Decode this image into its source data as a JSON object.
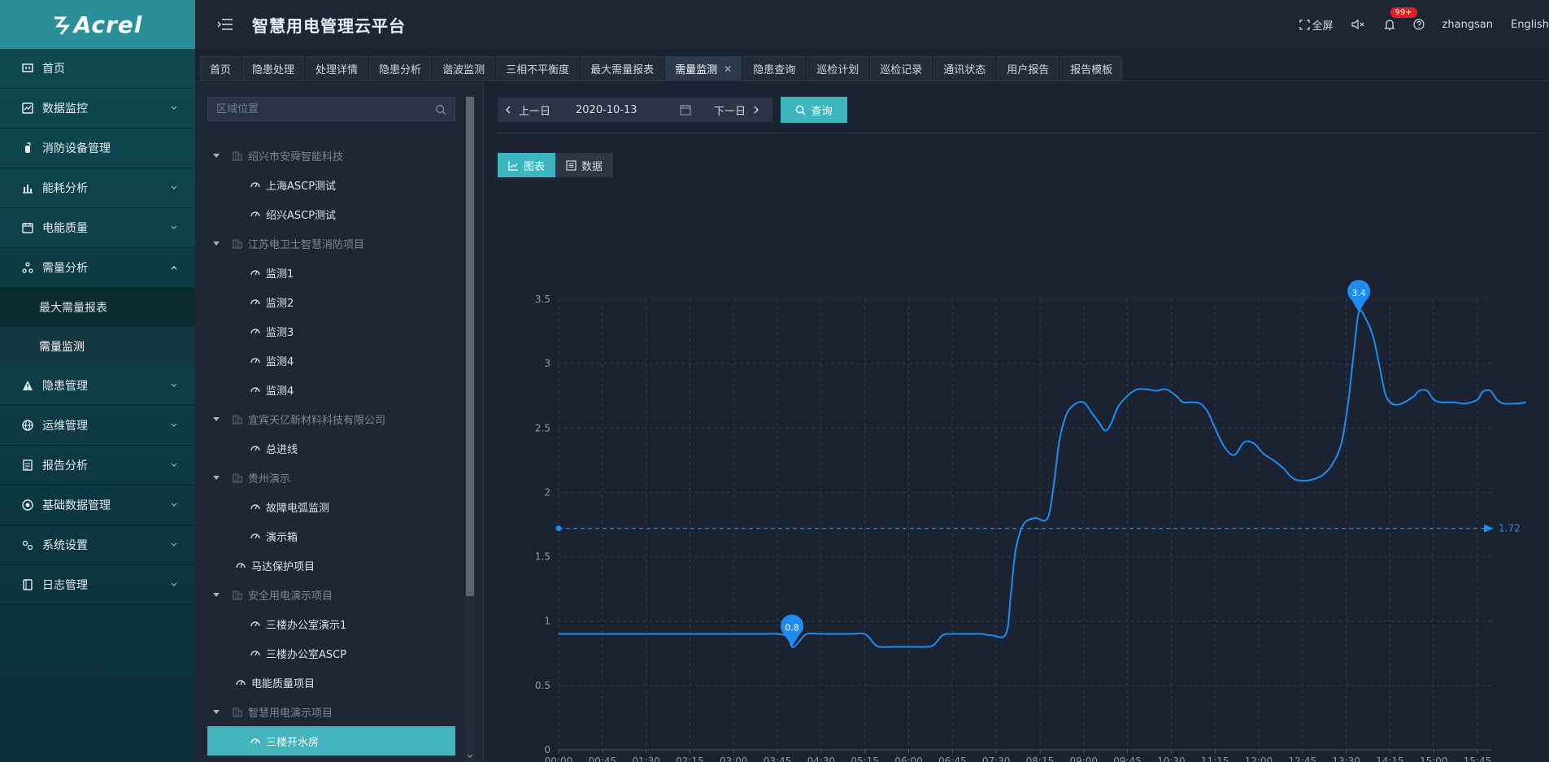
{
  "app": {
    "logo": "Acrel",
    "title": "智慧用电管理云平台"
  },
  "header": {
    "fullscreen": "全屏",
    "badge": "99+",
    "user": "zhangsan",
    "language": "English"
  },
  "sidebar": {
    "items": [
      {
        "label": "首页",
        "icon": "home-icon"
      },
      {
        "label": "数据监控",
        "icon": "monitor-icon"
      },
      {
        "label": "消防设备管理",
        "icon": "extinguisher-icon"
      },
      {
        "label": "能耗分析",
        "icon": "bar-chart-icon"
      },
      {
        "label": "电能质量",
        "icon": "calendar-icon"
      },
      {
        "label": "需量分析",
        "icon": "nodes-icon"
      },
      {
        "label": "隐患管理",
        "icon": "warning-icon"
      },
      {
        "label": "运维管理",
        "icon": "globe-icon"
      },
      {
        "label": "报告分析",
        "icon": "report-icon"
      },
      {
        "label": "基础数据管理",
        "icon": "database-icon"
      },
      {
        "label": "系统设置",
        "icon": "settings-icon"
      },
      {
        "label": "日志管理",
        "icon": "log-icon"
      }
    ],
    "submenu": [
      {
        "label": "最大需量报表"
      },
      {
        "label": "需量监测"
      }
    ]
  },
  "tabs": [
    {
      "label": "首页"
    },
    {
      "label": "隐患处理"
    },
    {
      "label": "处理详情"
    },
    {
      "label": "隐患分析"
    },
    {
      "label": "谐波监测"
    },
    {
      "label": "三相不平衡度"
    },
    {
      "label": "最大需量报表"
    },
    {
      "label": "需量监测"
    },
    {
      "label": "隐患查询"
    },
    {
      "label": "巡检计划"
    },
    {
      "label": "巡检记录"
    },
    {
      "label": "通讯状态"
    },
    {
      "label": "用户报告"
    },
    {
      "label": "报告模板"
    }
  ],
  "tree": {
    "placeholder": "区域位置",
    "nodes": [
      {
        "label": "绍兴市安舜智能科技",
        "level": 0
      },
      {
        "label": "上海ASCP测试",
        "level": 1
      },
      {
        "label": "绍兴ASCP测试",
        "level": 1
      },
      {
        "label": "江苏电卫士智慧消防项目",
        "level": 0
      },
      {
        "label": "监测1",
        "level": 1
      },
      {
        "label": "监测2",
        "level": 1
      },
      {
        "label": "监测3",
        "level": 1
      },
      {
        "label": "监测4",
        "level": 1
      },
      {
        "label": "监测4",
        "level": 1
      },
      {
        "label": "宜宾天亿新材料科技有限公司",
        "level": 0
      },
      {
        "label": "总进线",
        "level": 1
      },
      {
        "label": "贵州演示",
        "level": 0
      },
      {
        "label": "故障电弧监测",
        "level": 1
      },
      {
        "label": "演示箱",
        "level": 1
      },
      {
        "label": "马达保护项目",
        "level": 2
      },
      {
        "label": "安全用电演示项目",
        "level": 0
      },
      {
        "label": "三楼办公室演示1",
        "level": 1
      },
      {
        "label": "三楼办公室ASCP",
        "level": 1
      },
      {
        "label": "电能质量项目",
        "level": 2
      },
      {
        "label": "智慧用电演示项目",
        "level": 0
      },
      {
        "label": "三楼开水房",
        "level": 1,
        "selected": true
      }
    ]
  },
  "toolbar": {
    "prev": "上一日",
    "date": "2020-10-13",
    "next": "下一日",
    "query": "查询"
  },
  "view_toggle": {
    "chart": "图表",
    "data": "数据"
  },
  "colors": {
    "accent": "#3db5bf",
    "line": "#1e8cf0",
    "badge": "#e02020"
  },
  "chart_data": {
    "type": "line",
    "x_ticks": [
      "00:00",
      "00:45",
      "01:30",
      "02:15",
      "03:00",
      "03:45",
      "04:30",
      "05:15",
      "06:00",
      "06:45",
      "07:30",
      "08:15",
      "09:00",
      "09:45",
      "10:30",
      "11:15",
      "12:00",
      "12:45",
      "13:30",
      "14:15",
      "15:00",
      "15:45"
    ],
    "y_ticks": [
      "0",
      "0.5",
      "1",
      "1.5",
      "2",
      "2.5",
      "3",
      "3.5"
    ],
    "ylim": [
      0,
      3.5
    ],
    "x_range_minutes": [
      0,
      960
    ],
    "grid": true,
    "series": [
      {
        "points": [
          [
            0,
            0.9
          ],
          [
            45,
            0.9
          ],
          [
            90,
            0.9
          ],
          [
            135,
            0.9
          ],
          [
            180,
            0.9
          ],
          [
            210,
            0.9
          ],
          [
            225,
            0.9
          ],
          [
            235,
            0.88
          ],
          [
            240,
            0.8
          ],
          [
            245,
            0.82
          ],
          [
            255,
            0.9
          ],
          [
            270,
            0.9
          ],
          [
            285,
            0.9
          ],
          [
            300,
            0.9
          ],
          [
            315,
            0.9
          ],
          [
            325,
            0.82
          ],
          [
            330,
            0.8
          ],
          [
            345,
            0.8
          ],
          [
            360,
            0.8
          ],
          [
            375,
            0.8
          ],
          [
            385,
            0.81
          ],
          [
            395,
            0.89
          ],
          [
            405,
            0.9
          ],
          [
            420,
            0.9
          ],
          [
            435,
            0.9
          ],
          [
            445,
            0.89
          ],
          [
            460,
            0.9
          ],
          [
            465,
            1.2
          ],
          [
            470,
            1.55
          ],
          [
            478,
            1.75
          ],
          [
            490,
            1.8
          ],
          [
            500,
            1.78
          ],
          [
            505,
            1.85
          ],
          [
            510,
            2.1
          ],
          [
            515,
            2.4
          ],
          [
            522,
            2.6
          ],
          [
            530,
            2.68
          ],
          [
            540,
            2.7
          ],
          [
            548,
            2.62
          ],
          [
            555,
            2.55
          ],
          [
            562,
            2.48
          ],
          [
            568,
            2.53
          ],
          [
            575,
            2.66
          ],
          [
            585,
            2.75
          ],
          [
            595,
            2.8
          ],
          [
            605,
            2.8
          ],
          [
            615,
            2.79
          ],
          [
            625,
            2.8
          ],
          [
            635,
            2.75
          ],
          [
            642,
            2.7
          ],
          [
            650,
            2.7
          ],
          [
            660,
            2.69
          ],
          [
            668,
            2.62
          ],
          [
            675,
            2.5
          ],
          [
            685,
            2.35
          ],
          [
            695,
            2.29
          ],
          [
            705,
            2.39
          ],
          [
            715,
            2.38
          ],
          [
            725,
            2.3
          ],
          [
            735,
            2.25
          ],
          [
            745,
            2.19
          ],
          [
            755,
            2.11
          ],
          [
            765,
            2.09
          ],
          [
            775,
            2.1
          ],
          [
            785,
            2.13
          ],
          [
            795,
            2.21
          ],
          [
            805,
            2.38
          ],
          [
            812,
            2.7
          ],
          [
            818,
            3.1
          ],
          [
            823,
            3.4
          ],
          [
            830,
            3.35
          ],
          [
            838,
            3.2
          ],
          [
            845,
            2.95
          ],
          [
            850,
            2.77
          ],
          [
            855,
            2.7
          ],
          [
            862,
            2.68
          ],
          [
            870,
            2.7
          ],
          [
            880,
            2.75
          ],
          [
            885,
            2.79
          ],
          [
            893,
            2.79
          ],
          [
            900,
            2.72
          ],
          [
            908,
            2.7
          ],
          [
            920,
            2.7
          ],
          [
            932,
            2.69
          ],
          [
            945,
            2.72
          ],
          [
            950,
            2.78
          ],
          [
            958,
            2.79
          ],
          [
            965,
            2.72
          ],
          [
            972,
            2.69
          ],
          [
            985,
            2.69
          ],
          [
            995,
            2.7
          ]
        ]
      }
    ],
    "markers": [
      {
        "label": "0.8",
        "x": 240,
        "y": 0.8
      },
      {
        "label": "3.4",
        "x": 823,
        "y": 3.4
      }
    ],
    "reference_line": {
      "value": 1.72,
      "label": "1.72"
    }
  }
}
